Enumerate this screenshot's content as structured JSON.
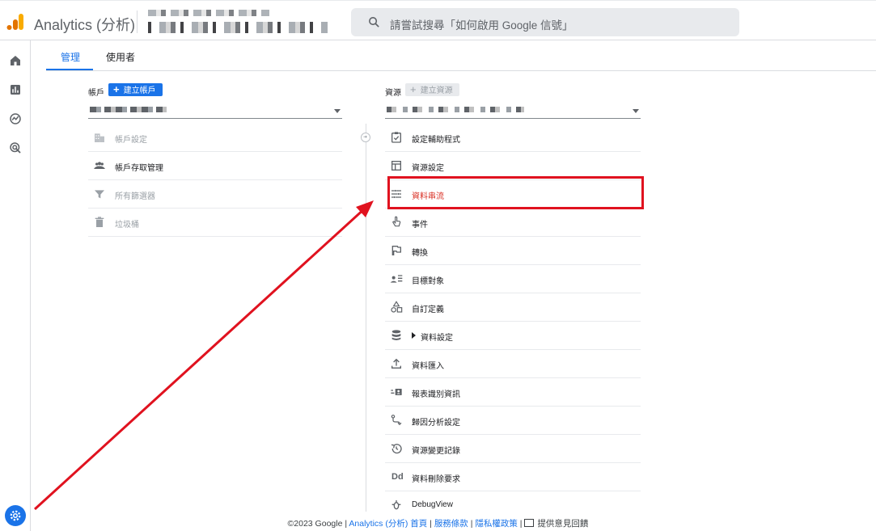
{
  "header": {
    "app_title": "Analytics (分析)",
    "search_placeholder": "請嘗試搜尋「如何啟用 Google 信號」"
  },
  "tabs": [
    {
      "label": "管理",
      "active": true
    },
    {
      "label": "使用者",
      "active": false
    }
  ],
  "account_column": {
    "label": "帳戶",
    "create_button": "建立帳戶",
    "items": [
      {
        "label": "帳戶設定",
        "icon": "building-icon",
        "enabled": false
      },
      {
        "label": "帳戶存取管理",
        "icon": "people-icon",
        "enabled": true
      },
      {
        "label": "所有篩選器",
        "icon": "filter-icon",
        "enabled": false
      },
      {
        "label": "垃圾桶",
        "icon": "trash-icon",
        "enabled": false
      }
    ]
  },
  "property_column": {
    "label": "資源",
    "create_button": "建立資源",
    "items": [
      {
        "label": "設定輔助程式",
        "icon": "checklist-icon"
      },
      {
        "label": "資源設定",
        "icon": "layout-icon"
      },
      {
        "label": "資料串流",
        "icon": "stream-icon",
        "highlighted": true
      },
      {
        "label": "事件",
        "icon": "touch-icon"
      },
      {
        "label": "轉換",
        "icon": "flag-icon"
      },
      {
        "label": "目標對象",
        "icon": "audience-icon"
      },
      {
        "label": "自訂定義",
        "icon": "shapes-icon"
      },
      {
        "label": "資料設定",
        "icon": "database-icon",
        "expandable": true
      },
      {
        "label": "資料匯入",
        "icon": "upload-icon"
      },
      {
        "label": "報表識別資訊",
        "icon": "identity-icon"
      },
      {
        "label": "歸因分析設定",
        "icon": "attribution-icon"
      },
      {
        "label": "資源變更記錄",
        "icon": "history-icon"
      },
      {
        "label": "資料刪除要求",
        "icon": "dd-icon"
      },
      {
        "label": "DebugView",
        "icon": "bug-icon"
      }
    ]
  },
  "footer": {
    "copyright": "©2023 Google | ",
    "home_link": "Analytics (分析) 首頁",
    "sep1": " | ",
    "terms_link": "服務條款",
    "sep2": " | ",
    "privacy_link": "隱私權政策",
    "sep3": " | ",
    "feedback": "提供意見回饋"
  },
  "colors": {
    "accent": "#1a73e8",
    "highlight": "#e0121f",
    "logo_orange": "#f9ab00",
    "logo_dark": "#e37400"
  }
}
